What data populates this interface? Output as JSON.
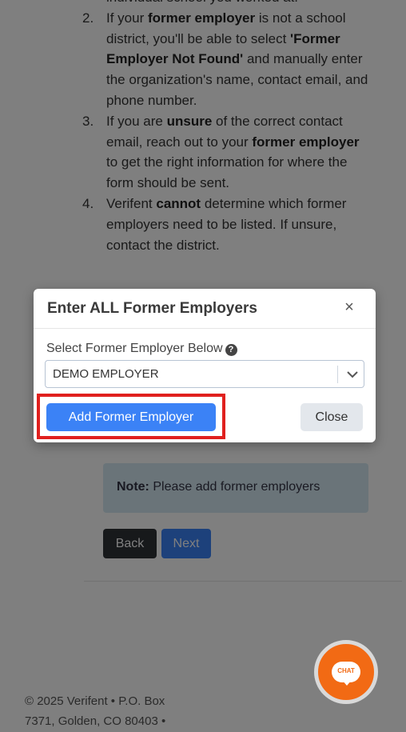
{
  "instructions": [
    {
      "num": "",
      "html_parts": [
        {
          "t": "individual school you worked at.",
          "b": false
        }
      ]
    },
    {
      "num": "2.",
      "html_parts": [
        {
          "t": "If your ",
          "b": false
        },
        {
          "t": "former employer",
          "b": true
        },
        {
          "t": " is not a school district, you'll be able to select ",
          "b": false
        },
        {
          "t": "'Former Employer Not Found'",
          "b": true
        },
        {
          "t": " and manually enter the organization's name, contact email, and phone number.",
          "b": false
        }
      ]
    },
    {
      "num": "3.",
      "html_parts": [
        {
          "t": "If you are ",
          "b": false
        },
        {
          "t": "unsure",
          "b": true
        },
        {
          "t": " of the correct contact email, reach out to your ",
          "b": false
        },
        {
          "t": "former employer",
          "b": true
        },
        {
          "t": " to get the right information for where the form should be sent.",
          "b": false
        }
      ]
    },
    {
      "num": "4.",
      "html_parts": [
        {
          "t": "Verifent ",
          "b": false
        },
        {
          "t": "cannot",
          "b": true
        },
        {
          "t": " determine which former employers need to be listed. If unsure, contact the district.",
          "b": false
        }
      ]
    }
  ],
  "note": {
    "label": "Note:",
    "text": " Please add former employers"
  },
  "buttons": {
    "back": "Back",
    "next": "Next"
  },
  "footer": {
    "line1": "© 2025 Verifent • P.O. Box",
    "line2": "7371, Golden, CO 80403 •"
  },
  "modal": {
    "title": "Enter ALL Former Employers",
    "close_icon": "×",
    "select_label": "Select Former Employer Below",
    "help_icon": "?",
    "selected_value": "DEMO EMPLOYER",
    "add_button": "Add Former Employer",
    "close_button": "Close"
  },
  "chat": {
    "label": "CHAT",
    "color": "#f26a14"
  },
  "colors": {
    "primary": "#3b82f6",
    "highlight": "#e0201e",
    "dark": "#2f3237"
  }
}
